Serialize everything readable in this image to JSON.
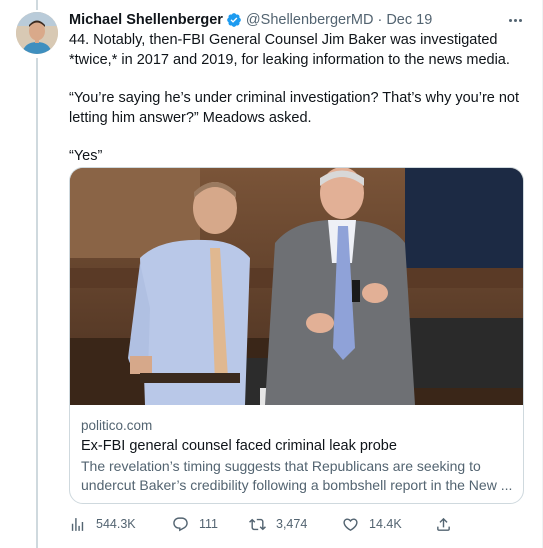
{
  "author": {
    "display_name": "Michael Shellenberger",
    "handle": "@ShellenbergerMD",
    "separator": "·",
    "date": "Dec 19",
    "verified": true
  },
  "tweet": {
    "paragraphs": [
      "44. Notably, then-FBI General Counsel Jim Baker was investigated *twice,* in 2017 and 2019, for leaking information to the news media.",
      "“You’re saying he’s under criminal investigation? That’s why you’re not letting him answer?” Meadows asked.",
      "“Yes”"
    ]
  },
  "card": {
    "domain": "politico.com",
    "title": "Ex-FBI general counsel faced criminal leak probe",
    "description_line1": "The revelation’s timing suggests that Republicans are seeking to",
    "description_line2": "undercut Baker’s credibility following a bombshell report in the New ..."
  },
  "actions": {
    "views": "544.3K",
    "replies": "111",
    "retweets": "3,474",
    "likes": "14.4K"
  },
  "colors": {
    "text": "#0f1419",
    "secondary": "#536471",
    "verified": "#1d9bf0",
    "border": "#cfd9de"
  },
  "icons": [
    "verified-badge-icon",
    "more-icon",
    "views-icon",
    "reply-icon",
    "retweet-icon",
    "like-icon",
    "share-icon"
  ]
}
